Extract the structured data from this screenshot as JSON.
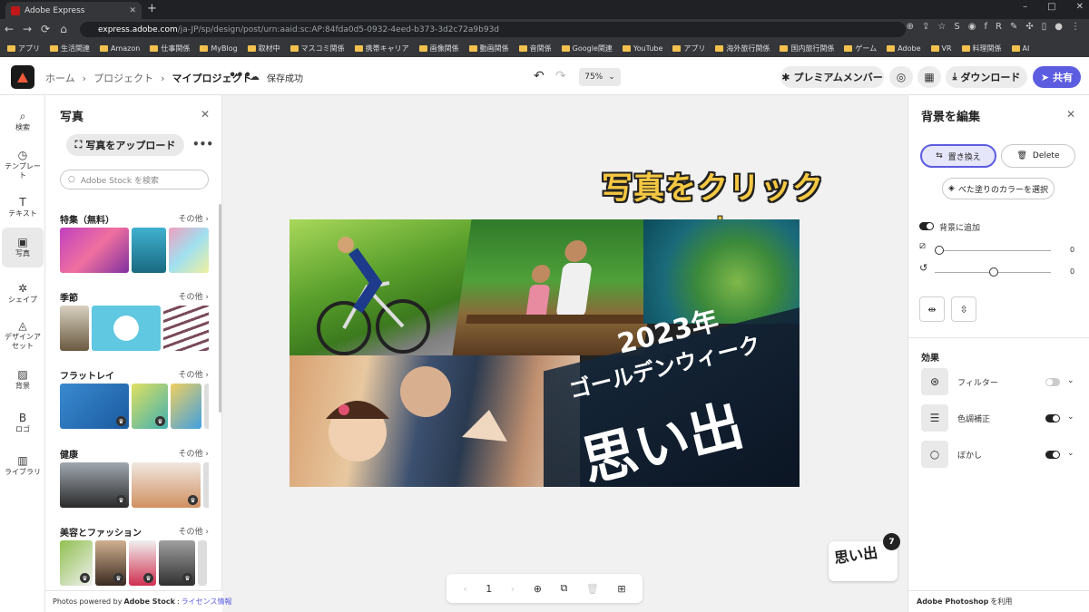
{
  "browser": {
    "tab_title": "Adobe Express",
    "tab_close": "✕",
    "new_tab": "+",
    "window_controls": [
      "–",
      "□",
      "✕"
    ],
    "nav": [
      "←",
      "→",
      "⟳",
      "⌂"
    ],
    "url_domain": "express.adobe.com",
    "url_path": "/ja-JP/sp/design/post/urn:aaid:sc:AP:84fda0d5-0932-4eed-b373-3d2c72a9b93d",
    "bookmarks": [
      "アプリ",
      "生活関連",
      "Amazon",
      "仕事関係",
      "MyBlog",
      "取材中",
      "マスコミ関係",
      "携帯キャリア",
      "画像関係",
      "動画関係",
      "音関係",
      "Google関連",
      "YouTube",
      "アプリ",
      "海外旅行関係",
      "国内旅行関係",
      "ゲーム",
      "Adobe",
      "VR",
      "料理関係",
      "AI"
    ]
  },
  "header": {
    "breadcrumb": [
      "ホーム",
      "プロジェクト",
      "マイプロジェクト"
    ],
    "more": "•••",
    "save_status": "保存成功",
    "zoom": "75%",
    "premium": "プレミアムメンバー",
    "download": "ダウンロード",
    "share": "共有"
  },
  "rail": [
    {
      "icon": "search-icon",
      "glyph": "⌕",
      "label": "検索"
    },
    {
      "icon": "template-icon",
      "glyph": "◷",
      "label": "テンプレート"
    },
    {
      "icon": "text-icon",
      "glyph": "T",
      "label": "テキスト"
    },
    {
      "icon": "photo-icon",
      "glyph": "▣",
      "label": "写真"
    },
    {
      "icon": "shape-icon",
      "glyph": "✲",
      "label": "シェイプ"
    },
    {
      "icon": "asset-icon",
      "glyph": "◬",
      "label": "デザインアセット"
    },
    {
      "icon": "background-icon",
      "glyph": "▨",
      "label": "背景"
    },
    {
      "icon": "logo-icon",
      "glyph": "B",
      "label": "ロゴ"
    },
    {
      "icon": "library-icon",
      "glyph": "▥",
      "label": "ライブラリ"
    }
  ],
  "panel": {
    "title": "写真",
    "upload": "写真をアップロード",
    "search_placeholder": "Adobe Stock を検索",
    "more_label": "その他 ›",
    "sections": [
      "特集（無料）",
      "季節",
      "フラットレイ",
      "健康",
      "美容とファッション"
    ],
    "footer_prefix": "Photos powered by",
    "footer_brand": "Adobe Stock",
    "footer_sep": ":",
    "footer_link": "ライセンス情報"
  },
  "canvas": {
    "annotation": "写真をクリック",
    "arrow": "↓",
    "design_text": [
      "2023年",
      "ゴールデンウィーク",
      "思い出"
    ],
    "page_thumb_text": "思い出",
    "page_count": "7",
    "page_number": "1",
    "bottom": [
      "‹",
      "1",
      "›",
      "⊕",
      "⧉",
      "🗑",
      "⊞"
    ]
  },
  "right_panel": {
    "title": "背景を編集",
    "replace": "置き換え",
    "delete": "Delete",
    "fill_color": "べた塗りのカラーを選択",
    "add_to_bg": "背景に追加",
    "slider1_value": "0",
    "slider2_value": "0",
    "effects_title": "効果",
    "effects": [
      {
        "label": "フィルター",
        "on": false
      },
      {
        "label": "色調補正",
        "on": true
      },
      {
        "label": "ぼかし",
        "on": true
      }
    ],
    "footer_brand": "Adobe Photoshop",
    "footer_suffix": "を利用"
  },
  "colors": {
    "accent": "#5c5ce0",
    "annotation": "#f5c842"
  }
}
